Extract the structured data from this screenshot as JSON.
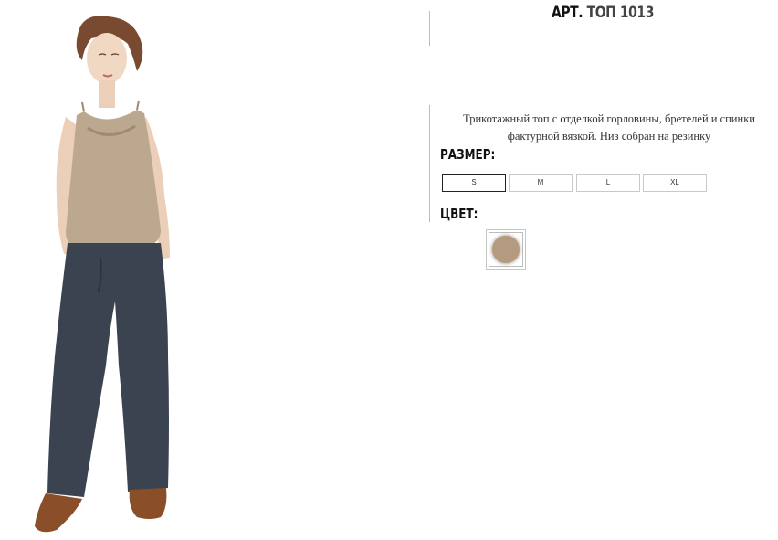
{
  "product": {
    "title_prefix": "АРТ.",
    "title_code": "ТОП 1013",
    "description": "Трикотажный топ с отделкой горловины, бретелей и спинки фактурной вязкой. Низ собран на резинку",
    "size_label": "РАЗМЕР:",
    "sizes": [
      "S",
      "M",
      "L",
      "XL"
    ],
    "selected_size": "S",
    "color_label": "ЦВЕТ:",
    "color_swatch": "#b49a80"
  },
  "colors": {
    "top_fabric": "#bca78f",
    "pants_fabric": "#3b4350",
    "shoes": "#8a4f28",
    "skin": "#f1d8c3",
    "hair": "#7a4a30"
  }
}
